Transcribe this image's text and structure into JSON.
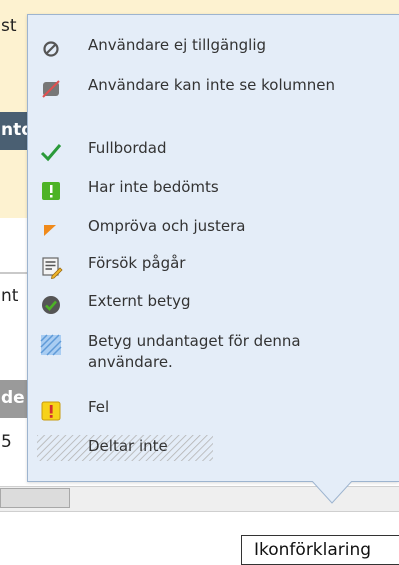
{
  "background": {
    "fragments": [
      "st",
      "ntd",
      "nt",
      "de",
      "5"
    ]
  },
  "legend": {
    "items": [
      {
        "icon": "unavailable-icon",
        "label": "Användare ej tillgänglig"
      },
      {
        "icon": "hidden-column-icon",
        "label": "Användare kan inte se kolumnen"
      },
      {
        "icon": "check-icon",
        "label": "Fullbordad"
      },
      {
        "icon": "not-graded-icon",
        "label": "Har inte bedömts"
      },
      {
        "icon": "corner-flag-icon",
        "label": "Ompröva och justera"
      },
      {
        "icon": "attempt-icon",
        "label": "Försök pågår"
      },
      {
        "icon": "external-grade-icon",
        "label": "Externt betyg"
      },
      {
        "icon": "exempt-icon",
        "label": "Betyg undantaget för denna användare."
      },
      {
        "icon": "error-icon",
        "label": "Fel"
      },
      {
        "icon": "not-participating-icon",
        "label": "Deltar inte"
      }
    ]
  },
  "footer": {
    "button_label": "Ikonförklaring"
  },
  "colors": {
    "popover_bg": "#e4edf8",
    "popover_border": "#9db4cf",
    "check_green": "#2a9a3a",
    "badge_green": "#4db326",
    "flag_orange": "#f08a1a",
    "error_yellow": "#f7d21a",
    "error_red": "#d32f2f",
    "exempt_blue": "#7fb2e5"
  }
}
